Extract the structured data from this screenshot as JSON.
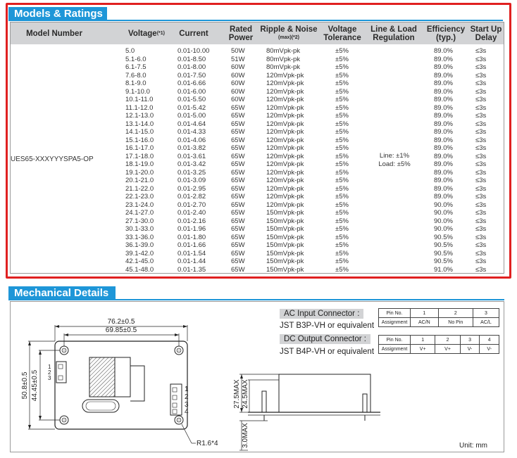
{
  "models_section": {
    "title": "Models & Ratings",
    "headers": {
      "model_number": "Model Number",
      "voltage": "Voltage",
      "voltage_note": "(*1)",
      "current": "Current",
      "rated_power_1": "Rated",
      "rated_power_2": "Power",
      "ripple_1": "Ripple & Noise",
      "ripple_note": "(max)(*2)",
      "voltage_tol_1": "Voltage",
      "voltage_tol_2": "Tolerance",
      "line_load_1": "Line & Load",
      "line_load_2": "Regulation",
      "efficiency_1": "Efficiency",
      "efficiency_2": "(typ.)",
      "startup_1": "Start Up",
      "startup_2": "Delay"
    },
    "model_number": "UES65-XXXYYYSPA5-OP",
    "line_regulation": "Line: ±1%",
    "load_regulation": "Load: ±5%",
    "rows": [
      {
        "voltage": "5.0",
        "current": "0.01-10.00",
        "power": "50W",
        "ripple": "80mVpk-pk",
        "tolerance": "±5%",
        "efficiency": "89.0%",
        "delay": "≤3s"
      },
      {
        "voltage": "5.1-6.0",
        "current": "0.01-8.50",
        "power": "51W",
        "ripple": "80mVpk-pk",
        "tolerance": "±5%",
        "efficiency": "89.0%",
        "delay": "≤3s"
      },
      {
        "voltage": "6.1-7.5",
        "current": "0.01-8.00",
        "power": "60W",
        "ripple": "80mVpk-pk",
        "tolerance": "±5%",
        "efficiency": "89.0%",
        "delay": "≤3s"
      },
      {
        "voltage": "7.6-8.0",
        "current": "0.01-7.50",
        "power": "60W",
        "ripple": "120mVpk-pk",
        "tolerance": "±5%",
        "efficiency": "89.0%",
        "delay": "≤3s"
      },
      {
        "voltage": "8.1-9.0",
        "current": "0.01-6.66",
        "power": "60W",
        "ripple": "120mVpk-pk",
        "tolerance": "±5%",
        "efficiency": "89.0%",
        "delay": "≤3s"
      },
      {
        "voltage": "9.1-10.0",
        "current": "0.01-6.00",
        "power": "60W",
        "ripple": "120mVpk-pk",
        "tolerance": "±5%",
        "efficiency": "89.0%",
        "delay": "≤3s"
      },
      {
        "voltage": "10.1-11.0",
        "current": "0.01-5.50",
        "power": "60W",
        "ripple": "120mVpk-pk",
        "tolerance": "±5%",
        "efficiency": "89.0%",
        "delay": "≤3s"
      },
      {
        "voltage": "11.1-12.0",
        "current": "0.01-5.42",
        "power": "65W",
        "ripple": "120mVpk-pk",
        "tolerance": "±5%",
        "efficiency": "89.0%",
        "delay": "≤3s"
      },
      {
        "voltage": "12.1-13.0",
        "current": "0.01-5.00",
        "power": "65W",
        "ripple": "120mVpk-pk",
        "tolerance": "±5%",
        "efficiency": "89.0%",
        "delay": "≤3s"
      },
      {
        "voltage": "13.1-14.0",
        "current": "0.01-4.64",
        "power": "65W",
        "ripple": "120mVpk-pk",
        "tolerance": "±5%",
        "efficiency": "89.0%",
        "delay": "≤3s"
      },
      {
        "voltage": "14.1-15.0",
        "current": "0.01-4.33",
        "power": "65W",
        "ripple": "120mVpk-pk",
        "tolerance": "±5%",
        "efficiency": "89.0%",
        "delay": "≤3s"
      },
      {
        "voltage": "15.1-16.0",
        "current": "0.01-4.06",
        "power": "65W",
        "ripple": "120mVpk-pk",
        "tolerance": "±5%",
        "efficiency": "89.0%",
        "delay": "≤3s"
      },
      {
        "voltage": "16.1-17.0",
        "current": "0.01-3.82",
        "power": "65W",
        "ripple": "120mVpk-pk",
        "tolerance": "±5%",
        "efficiency": "89.0%",
        "delay": "≤3s"
      },
      {
        "voltage": "17.1-18.0",
        "current": "0.01-3.61",
        "power": "65W",
        "ripple": "120mVpk-pk",
        "tolerance": "±5%",
        "efficiency": "89.0%",
        "delay": "≤3s"
      },
      {
        "voltage": "18.1-19.0",
        "current": "0.01-3.42",
        "power": "65W",
        "ripple": "120mVpk-pk",
        "tolerance": "±5%",
        "efficiency": "89.0%",
        "delay": "≤3s"
      },
      {
        "voltage": "19.1-20.0",
        "current": "0.01-3.25",
        "power": "65W",
        "ripple": "120mVpk-pk",
        "tolerance": "±5%",
        "efficiency": "89.0%",
        "delay": "≤3s"
      },
      {
        "voltage": "20.1-21.0",
        "current": "0.01-3.09",
        "power": "65W",
        "ripple": "120mVpk-pk",
        "tolerance": "±5%",
        "efficiency": "89.0%",
        "delay": "≤3s"
      },
      {
        "voltage": "21.1-22.0",
        "current": "0.01-2.95",
        "power": "65W",
        "ripple": "120mVpk-pk",
        "tolerance": "±5%",
        "efficiency": "89.0%",
        "delay": "≤3s"
      },
      {
        "voltage": "22.1-23.0",
        "current": "0.01-2.82",
        "power": "65W",
        "ripple": "120mVpk-pk",
        "tolerance": "±5%",
        "efficiency": "89.0%",
        "delay": "≤3s"
      },
      {
        "voltage": "23.1-24.0",
        "current": "0.01-2.70",
        "power": "65W",
        "ripple": "120mVpk-pk",
        "tolerance": "±5%",
        "efficiency": "90.0%",
        "delay": "≤3s"
      },
      {
        "voltage": "24.1-27.0",
        "current": "0.01-2.40",
        "power": "65W",
        "ripple": "150mVpk-pk",
        "tolerance": "±5%",
        "efficiency": "90.0%",
        "delay": "≤3s"
      },
      {
        "voltage": "27.1-30.0",
        "current": "0.01-2.16",
        "power": "65W",
        "ripple": "150mVpk-pk",
        "tolerance": "±5%",
        "efficiency": "90.0%",
        "delay": "≤3s"
      },
      {
        "voltage": "30.1-33.0",
        "current": "0.01-1.96",
        "power": "65W",
        "ripple": "150mVpk-pk",
        "tolerance": "±5%",
        "efficiency": "90.0%",
        "delay": "≤3s"
      },
      {
        "voltage": "33.1-36.0",
        "current": "0.01-1.80",
        "power": "65W",
        "ripple": "150mVpk-pk",
        "tolerance": "±5%",
        "efficiency": "90.5%",
        "delay": "≤3s"
      },
      {
        "voltage": "36.1-39.0",
        "current": "0.01-1.66",
        "power": "65W",
        "ripple": "150mVpk-pk",
        "tolerance": "±5%",
        "efficiency": "90.5%",
        "delay": "≤3s"
      },
      {
        "voltage": "39.1-42.0",
        "current": "0.01-1.54",
        "power": "65W",
        "ripple": "150mVpk-pk",
        "tolerance": "±5%",
        "efficiency": "90.5%",
        "delay": "≤3s"
      },
      {
        "voltage": "42.1-45.0",
        "current": "0.01-1.44",
        "power": "65W",
        "ripple": "150mVpk-pk",
        "tolerance": "±5%",
        "efficiency": "90.5%",
        "delay": "≤3s"
      },
      {
        "voltage": "45.1-48.0",
        "current": "0.01-1.35",
        "power": "65W",
        "ripple": "150mVpk-pk",
        "tolerance": "±5%",
        "efficiency": "91.0%",
        "delay": "≤3s"
      }
    ]
  },
  "mechanical_section": {
    "title": "Mechanical Details",
    "dim_width_outer": "76.2±0.5",
    "dim_width_inner": "69.85±0.5",
    "dim_height_outer": "50.8±0.5",
    "dim_height_inner": "44.45±0.5",
    "corner_radius": "R1.6*4",
    "side_height_max": "27.5MAX",
    "side_component_max": "24.5MAX",
    "side_pin_max": "3.0MAX",
    "left_pins": [
      "1",
      "2",
      "3"
    ],
    "right_pins": [
      "1",
      "2",
      "3",
      "4"
    ],
    "unit": "Unit: mm",
    "ac_connector": {
      "label": "AC Input Connector :",
      "part": "JST B3P-VH or equivalent",
      "pin_header": "Pin No.",
      "assign_header": "Assignment",
      "pins": [
        "1",
        "2",
        "3"
      ],
      "assignments": [
        "AC/N",
        "No Pin",
        "AC/L"
      ]
    },
    "dc_connector": {
      "label": "DC Output Connector :",
      "part": "JST B4P-VH or equivalent",
      "pin_header": "Pin No.",
      "assign_header": "Assignment",
      "pins": [
        "1",
        "2",
        "3",
        "4"
      ],
      "assignments": [
        "V+",
        "V+",
        "V-",
        "V-"
      ]
    }
  },
  "colors": {
    "section_tab": "#1e96d8",
    "header_bg": "#d2d3d5",
    "highlight_border": "#e02020"
  }
}
